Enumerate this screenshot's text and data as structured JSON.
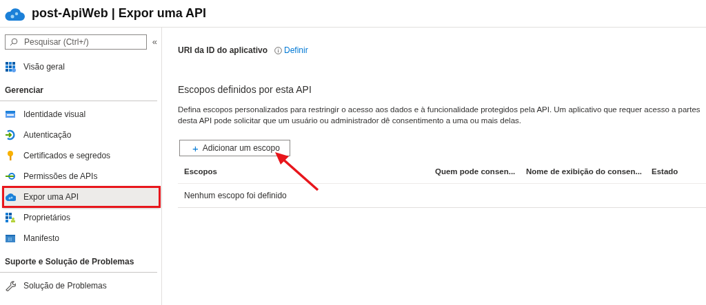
{
  "header": {
    "title": "post-ApiWeb | Expor uma API"
  },
  "sidebar": {
    "search": {
      "placeholder": "Pesquisar (Ctrl+/)"
    },
    "collapse": "«",
    "sections": [
      {
        "items": [
          {
            "label": "Visão geral",
            "selected": false,
            "boxed": false
          }
        ]
      },
      {
        "title": "Gerenciar",
        "items": [
          {
            "label": "Identidade visual",
            "selected": false,
            "boxed": false
          },
          {
            "label": "Autenticação",
            "selected": false,
            "boxed": false
          },
          {
            "label": "Certificados e segredos",
            "selected": false,
            "boxed": false
          },
          {
            "label": "Permissões de APIs",
            "selected": false,
            "boxed": false
          },
          {
            "label": "Expor uma API",
            "selected": true,
            "boxed": true
          },
          {
            "label": "Proprietários",
            "selected": false,
            "boxed": false
          },
          {
            "label": "Manifesto",
            "selected": false,
            "boxed": false
          }
        ]
      },
      {
        "title": "Suporte e Solução de Problemas",
        "items": [
          {
            "label": "Solução de Problemas",
            "selected": false,
            "boxed": false
          }
        ]
      }
    ]
  },
  "main": {
    "uri_label": "URI da ID do aplicativo",
    "uri_link": "Definir",
    "scopes_title": "Escopos definidos por esta API",
    "description": "Defina escopos personalizados para restringir o acesso aos dados e à funcionalidade protegidos pela API. Um aplicativo que requer acesso a partes desta API pode solicitar que um usuário ou administrador dê consentimento a uma ou mais delas.",
    "add_button": {
      "plus": "+",
      "label": "Adicionar um escopo"
    },
    "table": {
      "columns": [
        "Escopos",
        "Quem pode consen...",
        "Nome de exibição do consen...",
        "Estado"
      ],
      "empty": "Nenhum escopo foi definido"
    },
    "arrow": true
  }
}
